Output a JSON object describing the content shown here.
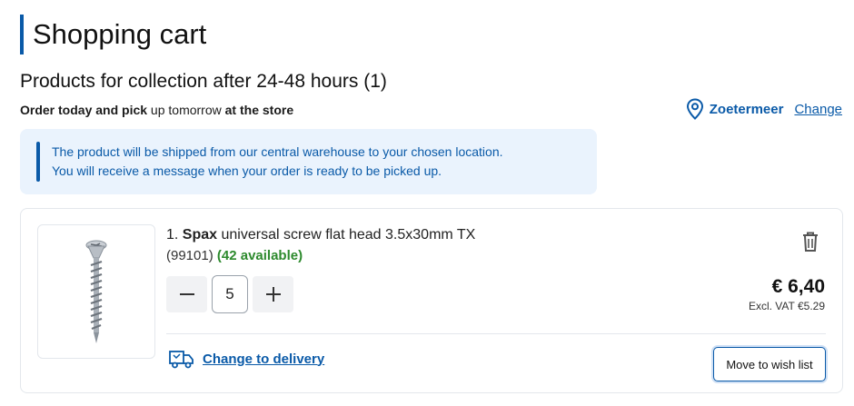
{
  "page": {
    "title": "Shopping cart"
  },
  "section": {
    "heading": "Products for collection after 24-48 hours (1)",
    "pickup_part1": "Order today and pick",
    "pickup_part2": " up tomorrow ",
    "pickup_part3": "at the store"
  },
  "store": {
    "name": "Zoetermeer",
    "change_label": "Change",
    "icon": "location-pin-icon"
  },
  "info": {
    "line1": "The product will be shipped from our central warehouse to your chosen location.",
    "line2": "You will receive a message when your order is ready to be picked up."
  },
  "item": {
    "index": "1.",
    "brand": "Spax",
    "name": " universal screw flat head 3.5x30mm TX",
    "article": "(99101)",
    "availability": "(42 available)",
    "quantity": "5",
    "price": "€ 6,40",
    "excl_vat": "Excl. VAT €5.29",
    "delivery_link": "Change to delivery",
    "wish_label": "Move to wish list",
    "icons": {
      "delete": "trash-icon",
      "decrease": "minus-icon",
      "increase": "plus-icon",
      "delivery": "truck-icon",
      "image": "screw-image"
    }
  },
  "colors": {
    "accent": "#0a5aa8",
    "available": "#2d8a2d",
    "info_bg": "#eaf3fd"
  }
}
